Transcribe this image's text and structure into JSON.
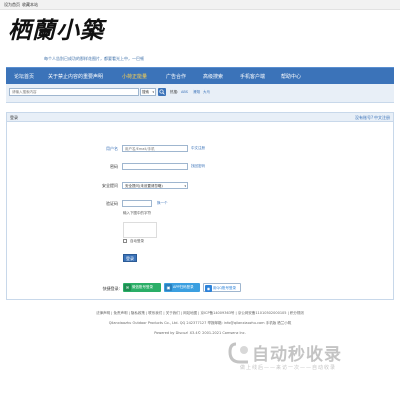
{
  "topbar": {
    "set_home": "设为首页",
    "bookmark": "收藏本站"
  },
  "logo": {
    "text": "栖蘭小築"
  },
  "slogan": "每个人告别已成功的那样花图片，都要看光上中，一巴顿",
  "nav": {
    "items": [
      {
        "label": "论坛首页"
      },
      {
        "label": "关于禁止内容的重要声明"
      },
      {
        "label": "小荷正能量"
      },
      {
        "label": "广告合作"
      },
      {
        "label": "高级搜索"
      },
      {
        "label": "手机客户端"
      },
      {
        "label": "帮助中心"
      }
    ]
  },
  "search": {
    "placeholder": "请输入搜索内容",
    "type_value": "搜索",
    "hot_label": "热搜:",
    "hot_terms": [
      "ABS",
      "滑翔",
      "大马"
    ]
  },
  "panel": {
    "title": "登录",
    "right_links": [
      "没有账号?",
      "中文注册"
    ]
  },
  "form": {
    "username_label": "用户名",
    "username_placeholder": "用户名/Email/手机",
    "register_link": "中文注册",
    "password_label": "密码",
    "forgot_link": "找回密码",
    "security_label": "安全提问",
    "security_value": "安全提问(未设置请忽略)",
    "captcha_label": "验证码",
    "captcha_refresh": "换一个",
    "captcha_hint": "输入下图中的字符",
    "remember_label": "自动登录",
    "login_button": "登录",
    "quick_label": "快捷登录:",
    "quick_buttons": [
      {
        "label": "微信账号登录",
        "icon": "wechat-icon",
        "color": "#2aae67"
      },
      {
        "label": "APP扫码登录",
        "icon": "app-icon",
        "color": "#3b9fe0"
      },
      {
        "label": "用QQ账号登录",
        "icon": "qq-icon",
        "color": "#2c82d9"
      }
    ]
  },
  "footer": {
    "line1": "法律声明 | 免责声明 | 隐私政策 | 联系我们 | 关于我们 | 网站地图 | 京ICP备14009363号 | 京公网安备11010502000105 | 积分规则",
    "line2": "Qilanxiaozhu Outdoor Products Co., Ltd.  QQ 242377127  举报邮箱: info@qilanxiaozhu.com  手机版  栖兰小筑",
    "line3": "Powered by Discuz! X3.4© 2001-2021 Comsenz Inc."
  },
  "watermark": {
    "title": "自动秒收录",
    "sub": "做上线后——来访一次——自动收录"
  },
  "colors": {
    "nav_bg": "#3b73b9",
    "nav_highlight": "#ffd34e",
    "link": "#3b73b9"
  }
}
